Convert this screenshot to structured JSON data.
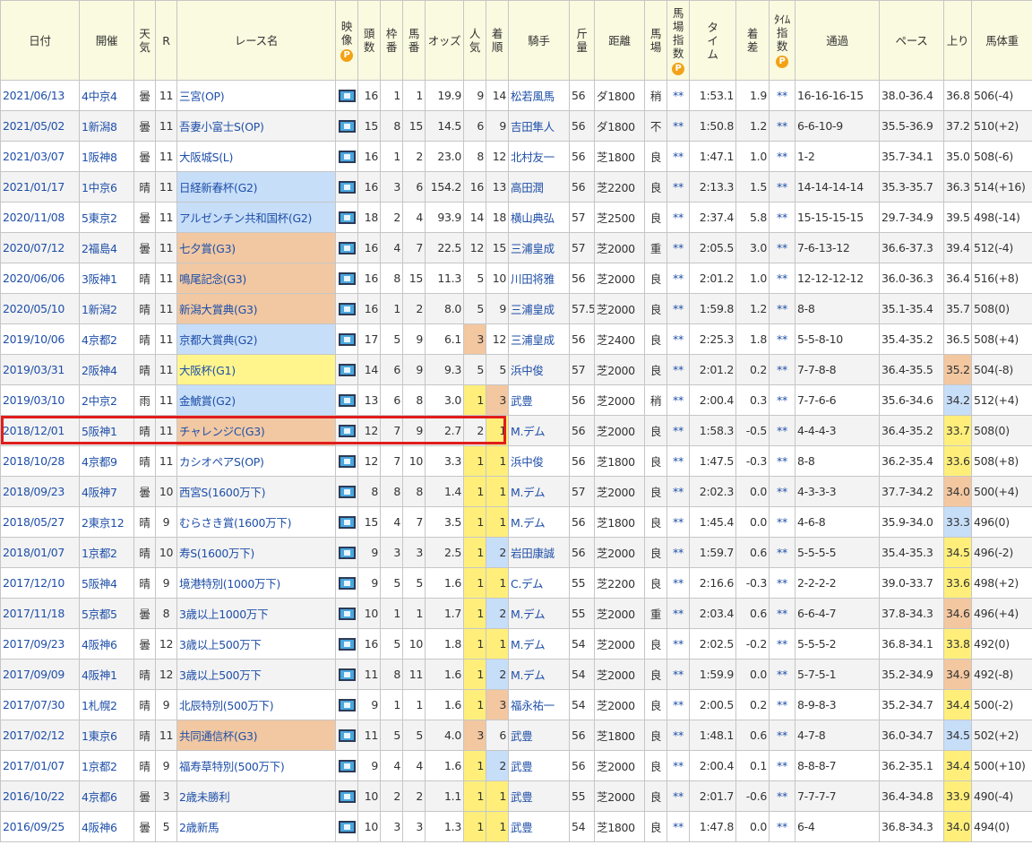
{
  "headers": [
    "日付",
    "開催",
    "天気",
    "R",
    "レース名",
    "映像",
    "頭数",
    "枠番",
    "馬番",
    "オッズ",
    "人気",
    "着順",
    "騎手",
    "斤量",
    "距離",
    "馬場",
    "馬場指数",
    "タイム",
    "着差",
    "タイム指数",
    "通過",
    "ペース",
    "上り",
    "馬体重"
  ],
  "header_lines": {
    "天気": [
      "天",
      "気"
    ],
    "映像": [
      "映",
      "像"
    ],
    "頭数": [
      "頭",
      "数"
    ],
    "枠番": [
      "枠",
      "番"
    ],
    "馬番": [
      "馬",
      "番"
    ],
    "人気": [
      "人",
      "気"
    ],
    "着順": [
      "着",
      "順"
    ],
    "斤量": [
      "斤",
      "量"
    ],
    "馬場": [
      "馬",
      "場"
    ],
    "馬場指数": [
      "馬",
      "場",
      "指",
      "数"
    ],
    "タイム": [
      "タ",
      "イ",
      "ム"
    ],
    "着差": [
      "着",
      "差"
    ],
    "タイム指数": [
      "ﾀｲﾑ",
      "指",
      "数"
    ]
  },
  "premium_badge": "P",
  "rows": [
    {
      "date": "2021/06/13",
      "venue": "4中京4",
      "weather": "曇",
      "r": "11",
      "race": "三宮(OP)",
      "grade": "",
      "heads": "16",
      "waku": "1",
      "umaban": "1",
      "odds": "19.9",
      "ninki": "9",
      "chaku": "14",
      "jockey": "松若風馬",
      "kinryo": "56",
      "dist": "ダ1800",
      "baba": "稍",
      "bsi": "**",
      "time": "1:53.1",
      "diff": "1.9",
      "ti": "**",
      "pass": "16-16-16-15",
      "pace": "38.0-36.4",
      "agari": "36.8",
      "weight": "506(-4)",
      "ag": ""
    },
    {
      "date": "2021/05/02",
      "venue": "1新潟8",
      "weather": "曇",
      "r": "11",
      "race": "吾妻小富士S(OP)",
      "grade": "",
      "heads": "15",
      "waku": "8",
      "umaban": "15",
      "odds": "14.5",
      "ninki": "6",
      "chaku": "9",
      "jockey": "吉田隼人",
      "kinryo": "56",
      "dist": "ダ1800",
      "baba": "不",
      "bsi": "**",
      "time": "1:50.8",
      "diff": "1.2",
      "ti": "**",
      "pass": "6-6-10-9",
      "pace": "35.5-36.9",
      "agari": "37.2",
      "weight": "510(+2)",
      "ag": ""
    },
    {
      "date": "2021/03/07",
      "venue": "1阪神8",
      "weather": "曇",
      "r": "11",
      "race": "大阪城S(L)",
      "grade": "",
      "heads": "16",
      "waku": "1",
      "umaban": "2",
      "odds": "23.0",
      "ninki": "8",
      "chaku": "12",
      "jockey": "北村友一",
      "kinryo": "56",
      "dist": "芝1800",
      "baba": "良",
      "bsi": "**",
      "time": "1:47.1",
      "diff": "1.0",
      "ti": "**",
      "pass": "1-2",
      "pace": "35.7-34.1",
      "agari": "35.0",
      "weight": "508(-6)",
      "ag": ""
    },
    {
      "date": "2021/01/17",
      "venue": "1中京6",
      "weather": "晴",
      "r": "11",
      "race": "日経新春杯(G2)",
      "grade": "g2",
      "heads": "16",
      "waku": "3",
      "umaban": "6",
      "odds": "154.2",
      "ninki": "16",
      "chaku": "13",
      "jockey": "高田潤",
      "kinryo": "56",
      "dist": "芝2200",
      "baba": "良",
      "bsi": "**",
      "time": "2:13.3",
      "diff": "1.5",
      "ti": "**",
      "pass": "14-14-14-14",
      "pace": "35.3-35.7",
      "agari": "36.3",
      "weight": "514(+16)",
      "ag": ""
    },
    {
      "date": "2020/11/08",
      "venue": "5東京2",
      "weather": "曇",
      "r": "11",
      "race": "アルゼンチン共和国杯(G2)",
      "grade": "g2",
      "heads": "18",
      "waku": "2",
      "umaban": "4",
      "odds": "93.9",
      "ninki": "14",
      "chaku": "18",
      "jockey": "横山典弘",
      "kinryo": "57",
      "dist": "芝2500",
      "baba": "良",
      "bsi": "**",
      "time": "2:37.4",
      "diff": "5.8",
      "ti": "**",
      "pass": "15-15-15-15",
      "pace": "29.7-34.9",
      "agari": "39.5",
      "weight": "498(-14)",
      "ag": ""
    },
    {
      "date": "2020/07/12",
      "venue": "2福島4",
      "weather": "曇",
      "r": "11",
      "race": "七夕賞(G3)",
      "grade": "g3",
      "heads": "16",
      "waku": "4",
      "umaban": "7",
      "odds": "22.5",
      "ninki": "12",
      "chaku": "15",
      "jockey": "三浦皇成",
      "kinryo": "57",
      "dist": "芝2000",
      "baba": "重",
      "bsi": "**",
      "time": "2:05.5",
      "diff": "3.0",
      "ti": "**",
      "pass": "7-6-13-12",
      "pace": "36.6-37.3",
      "agari": "39.4",
      "weight": "512(-4)",
      "ag": ""
    },
    {
      "date": "2020/06/06",
      "venue": "3阪神1",
      "weather": "晴",
      "r": "11",
      "race": "鳴尾記念(G3)",
      "grade": "g3",
      "heads": "16",
      "waku": "8",
      "umaban": "15",
      "odds": "11.3",
      "ninki": "5",
      "chaku": "10",
      "jockey": "川田将雅",
      "kinryo": "56",
      "dist": "芝2000",
      "baba": "良",
      "bsi": "**",
      "time": "2:01.2",
      "diff": "1.0",
      "ti": "**",
      "pass": "12-12-12-12",
      "pace": "36.0-36.3",
      "agari": "36.4",
      "weight": "516(+8)",
      "ag": ""
    },
    {
      "date": "2020/05/10",
      "venue": "1新潟2",
      "weather": "晴",
      "r": "11",
      "race": "新潟大賞典(G3)",
      "grade": "g3",
      "heads": "16",
      "waku": "1",
      "umaban": "2",
      "odds": "8.0",
      "ninki": "5",
      "chaku": "9",
      "jockey": "三浦皇成",
      "kinryo": "57.5",
      "dist": "芝2000",
      "baba": "良",
      "bsi": "**",
      "time": "1:59.8",
      "diff": "1.2",
      "ti": "**",
      "pass": "8-8",
      "pace": "35.1-35.4",
      "agari": "35.7",
      "weight": "508(0)",
      "ag": ""
    },
    {
      "date": "2019/10/06",
      "venue": "4京都2",
      "weather": "晴",
      "r": "11",
      "race": "京都大賞典(G2)",
      "grade": "g2",
      "heads": "17",
      "waku": "5",
      "umaban": "9",
      "odds": "6.1",
      "ninki": "3",
      "chaku": "12",
      "jockey": "三浦皇成",
      "kinryo": "56",
      "dist": "芝2400",
      "baba": "良",
      "bsi": "**",
      "time": "2:25.3",
      "diff": "1.8",
      "ti": "**",
      "pass": "5-5-8-10",
      "pace": "35.4-35.2",
      "agari": "36.5",
      "weight": "508(+4)",
      "ag": ""
    },
    {
      "date": "2019/03/31",
      "venue": "2阪神4",
      "weather": "晴",
      "r": "11",
      "race": "大阪杯(G1)",
      "grade": "g1",
      "heads": "14",
      "waku": "6",
      "umaban": "9",
      "odds": "9.3",
      "ninki": "5",
      "chaku": "5",
      "jockey": "浜中俊",
      "kinryo": "57",
      "dist": "芝2000",
      "baba": "良",
      "bsi": "**",
      "time": "2:01.2",
      "diff": "0.2",
      "ti": "**",
      "pass": "7-7-8-8",
      "pace": "36.4-35.5",
      "agari": "35.2",
      "weight": "504(-8)",
      "ag": "ag3"
    },
    {
      "date": "2019/03/10",
      "venue": "2中京2",
      "weather": "雨",
      "r": "11",
      "race": "金鯱賞(G2)",
      "grade": "g2",
      "heads": "13",
      "waku": "6",
      "umaban": "8",
      "odds": "3.0",
      "ninki": "1",
      "chaku": "3",
      "jockey": "武豊",
      "kinryo": "56",
      "dist": "芝2000",
      "baba": "稍",
      "bsi": "**",
      "time": "2:00.4",
      "diff": "0.3",
      "ti": "**",
      "pass": "7-7-6-6",
      "pace": "35.6-34.6",
      "agari": "34.2",
      "weight": "512(+4)",
      "ag": "ag2"
    },
    {
      "date": "2018/12/01",
      "venue": "5阪神1",
      "weather": "晴",
      "r": "11",
      "race": "チャレンジC(G3)",
      "grade": "g3",
      "heads": "12",
      "waku": "7",
      "umaban": "9",
      "odds": "2.7",
      "ninki": "2",
      "chaku": "1",
      "jockey": "M.デム",
      "kinryo": "56",
      "dist": "芝2000",
      "baba": "良",
      "bsi": "**",
      "time": "1:58.3",
      "diff": "-0.5",
      "ti": "**",
      "pass": "4-4-4-3",
      "pace": "36.4-35.2",
      "agari": "33.7",
      "weight": "508(0)",
      "ag": "ag1"
    },
    {
      "date": "2018/10/28",
      "venue": "4京都9",
      "weather": "晴",
      "r": "11",
      "race": "カシオペアS(OP)",
      "grade": "",
      "heads": "12",
      "waku": "7",
      "umaban": "10",
      "odds": "3.3",
      "ninki": "1",
      "chaku": "1",
      "jockey": "浜中俊",
      "kinryo": "56",
      "dist": "芝1800",
      "baba": "良",
      "bsi": "**",
      "time": "1:47.5",
      "diff": "-0.3",
      "ti": "**",
      "pass": "8-8",
      "pace": "36.2-35.4",
      "agari": "33.6",
      "weight": "508(+8)",
      "ag": "ag1"
    },
    {
      "date": "2018/09/23",
      "venue": "4阪神7",
      "weather": "曇",
      "r": "10",
      "race": "西宮S(1600万下)",
      "grade": "",
      "heads": "8",
      "waku": "8",
      "umaban": "8",
      "odds": "1.4",
      "ninki": "1",
      "chaku": "1",
      "jockey": "M.デム",
      "kinryo": "57",
      "dist": "芝2000",
      "baba": "良",
      "bsi": "**",
      "time": "2:02.3",
      "diff": "0.0",
      "ti": "**",
      "pass": "4-3-3-3",
      "pace": "37.7-34.2",
      "agari": "34.0",
      "weight": "500(+4)",
      "ag": "ag3"
    },
    {
      "date": "2018/05/27",
      "venue": "2東京12",
      "weather": "晴",
      "r": "9",
      "race": "むらさき賞(1600万下)",
      "grade": "",
      "heads": "15",
      "waku": "4",
      "umaban": "7",
      "odds": "3.5",
      "ninki": "1",
      "chaku": "1",
      "jockey": "M.デム",
      "kinryo": "56",
      "dist": "芝1800",
      "baba": "良",
      "bsi": "**",
      "time": "1:45.4",
      "diff": "0.0",
      "ti": "**",
      "pass": "4-6-8",
      "pace": "35.9-34.0",
      "agari": "33.3",
      "weight": "496(0)",
      "ag": "ag2"
    },
    {
      "date": "2018/01/07",
      "venue": "1京都2",
      "weather": "晴",
      "r": "10",
      "race": "寿S(1600万下)",
      "grade": "",
      "heads": "9",
      "waku": "3",
      "umaban": "3",
      "odds": "2.5",
      "ninki": "1",
      "chaku": "2",
      "jockey": "岩田康誠",
      "kinryo": "56",
      "dist": "芝2000",
      "baba": "良",
      "bsi": "**",
      "time": "1:59.7",
      "diff": "0.6",
      "ti": "**",
      "pass": "5-5-5-5",
      "pace": "35.4-35.3",
      "agari": "34.5",
      "weight": "496(-2)",
      "ag": "ag1"
    },
    {
      "date": "2017/12/10",
      "venue": "5阪神4",
      "weather": "晴",
      "r": "9",
      "race": "境港特別(1000万下)",
      "grade": "",
      "heads": "9",
      "waku": "5",
      "umaban": "5",
      "odds": "1.6",
      "ninki": "1",
      "chaku": "1",
      "jockey": "C.デム",
      "kinryo": "55",
      "dist": "芝2200",
      "baba": "良",
      "bsi": "**",
      "time": "2:16.6",
      "diff": "-0.3",
      "ti": "**",
      "pass": "2-2-2-2",
      "pace": "39.0-33.7",
      "agari": "33.6",
      "weight": "498(+2)",
      "ag": "ag1"
    },
    {
      "date": "2017/11/18",
      "venue": "5京都5",
      "weather": "曇",
      "r": "8",
      "race": "3歳以上1000万下",
      "grade": "",
      "heads": "10",
      "waku": "1",
      "umaban": "1",
      "odds": "1.7",
      "ninki": "1",
      "chaku": "2",
      "jockey": "M.デム",
      "kinryo": "55",
      "dist": "芝2000",
      "baba": "重",
      "bsi": "**",
      "time": "2:03.4",
      "diff": "0.6",
      "ti": "**",
      "pass": "6-6-4-7",
      "pace": "37.8-34.3",
      "agari": "34.6",
      "weight": "496(+4)",
      "ag": "ag3"
    },
    {
      "date": "2017/09/23",
      "venue": "4阪神6",
      "weather": "曇",
      "r": "12",
      "race": "3歳以上500万下",
      "grade": "",
      "heads": "16",
      "waku": "5",
      "umaban": "10",
      "odds": "1.8",
      "ninki": "1",
      "chaku": "1",
      "jockey": "M.デム",
      "kinryo": "54",
      "dist": "芝2000",
      "baba": "良",
      "bsi": "**",
      "time": "2:02.5",
      "diff": "-0.2",
      "ti": "**",
      "pass": "5-5-5-2",
      "pace": "36.8-34.1",
      "agari": "33.8",
      "weight": "492(0)",
      "ag": "ag1"
    },
    {
      "date": "2017/09/09",
      "venue": "4阪神1",
      "weather": "晴",
      "r": "12",
      "race": "3歳以上500万下",
      "grade": "",
      "heads": "11",
      "waku": "8",
      "umaban": "11",
      "odds": "1.6",
      "ninki": "1",
      "chaku": "2",
      "jockey": "M.デム",
      "kinryo": "54",
      "dist": "芝2000",
      "baba": "良",
      "bsi": "**",
      "time": "1:59.9",
      "diff": "0.0",
      "ti": "**",
      "pass": "5-7-5-1",
      "pace": "35.2-34.9",
      "agari": "34.9",
      "weight": "492(-8)",
      "ag": "ag3"
    },
    {
      "date": "2017/07/30",
      "venue": "1札幌2",
      "weather": "晴",
      "r": "9",
      "race": "北辰特別(500万下)",
      "grade": "",
      "heads": "9",
      "waku": "1",
      "umaban": "1",
      "odds": "1.6",
      "ninki": "1",
      "chaku": "3",
      "jockey": "福永祐一",
      "kinryo": "54",
      "dist": "芝2000",
      "baba": "良",
      "bsi": "**",
      "time": "2:00.5",
      "diff": "0.2",
      "ti": "**",
      "pass": "8-9-8-3",
      "pace": "35.2-34.7",
      "agari": "34.4",
      "weight": "500(-2)",
      "ag": "ag1"
    },
    {
      "date": "2017/02/12",
      "venue": "1東京6",
      "weather": "晴",
      "r": "11",
      "race": "共同通信杯(G3)",
      "grade": "g3",
      "heads": "11",
      "waku": "5",
      "umaban": "5",
      "odds": "4.0",
      "ninki": "3",
      "chaku": "6",
      "jockey": "武豊",
      "kinryo": "56",
      "dist": "芝1800",
      "baba": "良",
      "bsi": "**",
      "time": "1:48.1",
      "diff": "0.6",
      "ti": "**",
      "pass": "4-7-8",
      "pace": "36.0-34.7",
      "agari": "34.5",
      "weight": "502(+2)",
      "ag": "ag2"
    },
    {
      "date": "2017/01/07",
      "venue": "1京都2",
      "weather": "晴",
      "r": "9",
      "race": "福寿草特別(500万下)",
      "grade": "",
      "heads": "9",
      "waku": "4",
      "umaban": "4",
      "odds": "1.6",
      "ninki": "1",
      "chaku": "2",
      "jockey": "武豊",
      "kinryo": "56",
      "dist": "芝2000",
      "baba": "良",
      "bsi": "**",
      "time": "2:00.4",
      "diff": "0.1",
      "ti": "**",
      "pass": "8-8-8-7",
      "pace": "36.2-35.1",
      "agari": "34.4",
      "weight": "500(+10)",
      "ag": "ag1"
    },
    {
      "date": "2016/10/22",
      "venue": "4京都6",
      "weather": "曇",
      "r": "3",
      "race": "2歳未勝利",
      "grade": "",
      "heads": "10",
      "waku": "2",
      "umaban": "2",
      "odds": "1.1",
      "ninki": "1",
      "chaku": "1",
      "jockey": "武豊",
      "kinryo": "55",
      "dist": "芝2000",
      "baba": "良",
      "bsi": "**",
      "time": "2:01.7",
      "diff": "-0.6",
      "ti": "**",
      "pass": "7-7-7-7",
      "pace": "36.4-34.8",
      "agari": "33.9",
      "weight": "490(-4)",
      "ag": "ag1"
    },
    {
      "date": "2016/09/25",
      "venue": "4阪神6",
      "weather": "曇",
      "r": "5",
      "race": "2歳新馬",
      "grade": "",
      "heads": "10",
      "waku": "3",
      "umaban": "3",
      "odds": "1.3",
      "ninki": "1",
      "chaku": "1",
      "jockey": "武豊",
      "kinryo": "54",
      "dist": "芝1800",
      "baba": "良",
      "bsi": "**",
      "time": "1:47.8",
      "diff": "0.0",
      "ti": "**",
      "pass": "6-4",
      "pace": "36.8-34.3",
      "agari": "34.0",
      "weight": "494(0)",
      "ag": "ag1"
    }
  ]
}
